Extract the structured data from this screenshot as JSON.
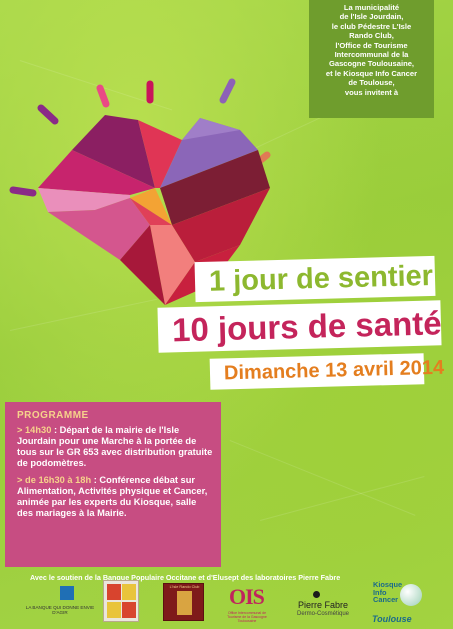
{
  "invite": {
    "lines": [
      "La municipalité",
      "de l'Isle Jourdain,",
      "le club Pédestre L'Isle",
      "Rando Club,",
      "l'Office de Tourisme",
      "Intercommunal de la",
      "Gascogne Toulousaine,",
      "et le Kiosque Info Cancer",
      "de Toulouse,",
      "vous invitent à"
    ]
  },
  "headline": {
    "line1": "1 jour de sentier",
    "line2": "10 jours de santé",
    "date": "Dimanche 13 avril 2014"
  },
  "programme": {
    "title": "PROGRAMME",
    "item1_time": "> 14h30",
    "item1_text": " : Départ de la mairie de l'Isle Jourdain pour une Marche à la portée de tous sur le GR 653 avec distribution gratuite de podomètres.",
    "item2_time": "> de 16h30 à 18h",
    "item2_text": " : Conférence débat sur Alimentation, Activités physique et Cancer, animée par les experts du Kiosque, salle des mariages à la Mairie."
  },
  "support": "Avec le soutien de la Banque Populaire Occitane et d'Elusept des laboratoires Pierre Fabre",
  "logos": {
    "bank_caption": "LA BANQUE QUI DONNE ENVIE D'AGIR",
    "rando_caption": "L'Isle Rando Club",
    "ois_text": "OIS",
    "ois_caption": "Office Intercommunal de Tourisme de la Gascogne Toulousaine",
    "pf_name": "Pierre Fabre",
    "pf_sub": "Dermo-Cosmétique",
    "kiosque_lines": [
      "Kiosque",
      "Info",
      "Cancer"
    ],
    "kiosque_town": "Toulouse"
  },
  "colors": {
    "background": "#a2d445",
    "invite_box": "#6f9d2d",
    "programme_box": "#c74d82",
    "line1_text": "#8db82f",
    "line2_text": "#c4245b",
    "date_text": "#e47e1f"
  }
}
